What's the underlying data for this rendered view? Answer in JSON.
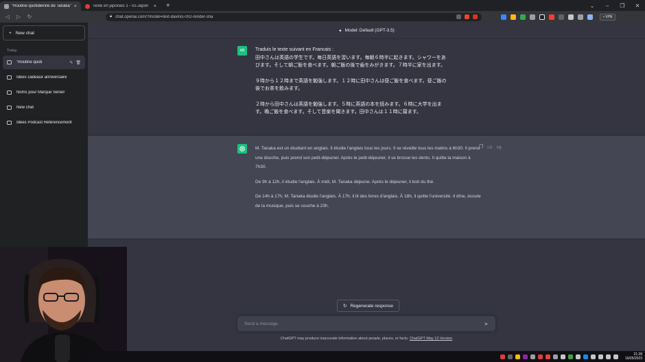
{
  "browser": {
    "tabs": [
      {
        "label": "\"Routine quotidienne de Tanaka\"",
        "close": "×",
        "favicon_color": "#9aa0a6"
      },
      {
        "label": "Texte en japonais 1 - Ici-Japon",
        "close": "×",
        "favicon_color": "#e53935"
      }
    ],
    "new_tab": "+",
    "window_controls": [
      "⌄",
      "–",
      "❐",
      "✕"
    ],
    "url": "chat.openai.com/?model=text-davinci-002-render-sha",
    "vpn_label": "• VPN"
  },
  "sidebar": {
    "new_chat_label": "New chat",
    "section_label": "Today",
    "items": [
      {
        "label": "\"Routine quoti",
        "active": true
      },
      {
        "label": "Idées cadeaux anniversaire",
        "active": false
      },
      {
        "label": "Noms pour Marque Senior",
        "active": false
      },
      {
        "label": "New chat",
        "active": false
      },
      {
        "label": "Idées Podcast Référencement",
        "active": false
      }
    ]
  },
  "main": {
    "model_label": "Model: Default (GPT-3.5)",
    "user_avatar": "AB",
    "user_lines": [
      "Traduis le texte suivant en Francais :",
      "田中さんは英語の学生です。毎日英語を習います。毎朝６時半に起きます。シャワーをあ",
      "びます。そして朝ご飯を食べます。朝ご飯の後で歯をみがきます。７時半に家を出ます。",
      "",
      "９時から１２時まで英語を勉強します。１２時に田中さんは昼ご飯を食べます。昼ご飯の",
      "後でお茶を飲みます。",
      "",
      "２時から田中さんは英語を勉強します。５時に英語の本を読みます。６時に大学を出ま",
      "す。晩ご飯を食べます。そして音楽を聞きます。田中さんは１１時に寝ます。"
    ],
    "assistant_paragraphs": [
      "M. Tanaka est un étudiant en anglais. Il étudie l'anglais tous les jours. Il se réveille tous les matins à 6h30. Il prend une douche, puis prend son petit-déjeuner. Après le petit-déjeuner, il se brosse les dents. Il quitte la maison à 7h30.",
      "De 9h à 12h, il étudie l'anglais. À midi, M. Tanaka déjeune. Après le déjeuner, il boit du thé.",
      "De 14h à 17h, M. Tanaka étudie l'anglais. À 17h, il lit des livres d'anglais. À 18h, il quitte l'université. Il dîne, écoute de la musique, puis se couche à 23h."
    ],
    "regenerate_label": "Regenerate response",
    "composer_placeholder": "Send a message.",
    "disclaimer_text": "ChatGPT may produce inaccurate information about people, places, or facts.",
    "disclaimer_link": "ChatGPT May 12 Version"
  },
  "taskbar": {
    "time": "21:28",
    "date": "16/05/2023"
  },
  "colors": {
    "accent_green": "#19c37d",
    "user_avatar_bg": "#19c37d"
  }
}
